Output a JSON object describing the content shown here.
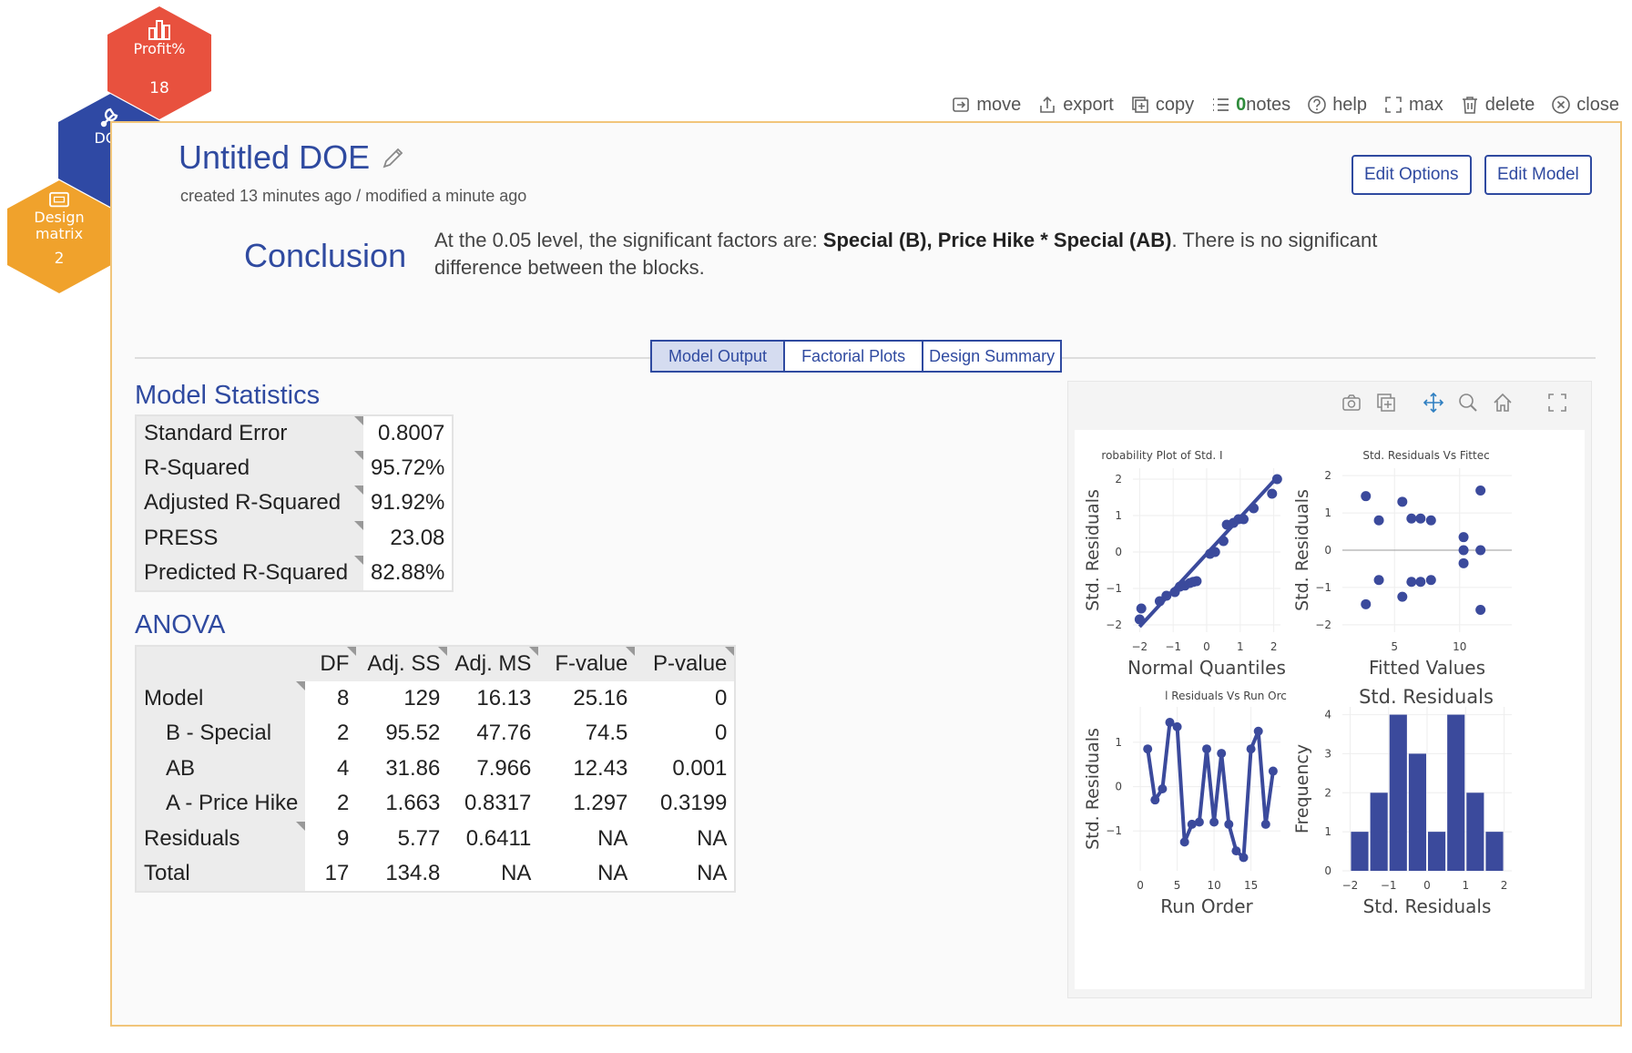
{
  "nav": {
    "profit": {
      "label": "Profit%",
      "count": "18"
    },
    "doe": {
      "label": "DOE"
    },
    "design": {
      "label_line1": "Design",
      "label_line2": "matrix",
      "count": "2"
    }
  },
  "toolbar": {
    "move": "move",
    "export": "export",
    "copy": "copy",
    "notes_count": "0",
    "notes": "notes",
    "help": "help",
    "max": "max",
    "delete": "delete",
    "close": "close"
  },
  "header": {
    "title": "Untitled DOE",
    "meta": "created 13 minutes ago / modified a minute ago",
    "edit_options": "Edit Options",
    "edit_model": "Edit Model"
  },
  "conclusion": {
    "title": "Conclusion",
    "text_before": "At the 0.05 level, the significant factors are: ",
    "text_bold": "Special (B), Price Hike * Special (AB)",
    "text_after": ". There is no significant difference between the blocks."
  },
  "tabs": [
    "Model Output",
    "Factorial Plots",
    "Design Summary"
  ],
  "model_stats": {
    "title": "Model Statistics",
    "rows": [
      {
        "label": "Standard Error",
        "value": "0.8007"
      },
      {
        "label": "R-Squared",
        "value": "95.72%"
      },
      {
        "label": "Adjusted R-Squared",
        "value": "91.92%"
      },
      {
        "label": "PRESS",
        "value": "23.08"
      },
      {
        "label": "Predicted R-Squared",
        "value": "82.88%"
      }
    ]
  },
  "anova": {
    "title": "ANOVA",
    "headers": [
      "DF",
      "Adj. SS",
      "Adj. MS",
      "F-value",
      "P-value"
    ],
    "rows": [
      {
        "label": "Model",
        "cells": [
          "8",
          "129",
          "16.13",
          "25.16",
          "0"
        ]
      },
      {
        "label": "B - Special",
        "cells": [
          "2",
          "95.52",
          "47.76",
          "74.5",
          "0"
        ]
      },
      {
        "label": "AB",
        "cells": [
          "4",
          "31.86",
          "7.966",
          "12.43",
          "0.001"
        ]
      },
      {
        "label": "A - Price Hike",
        "cells": [
          "2",
          "1.663",
          "0.8317",
          "1.297",
          "0.3199"
        ]
      },
      {
        "label": "Residuals",
        "cells": [
          "9",
          "5.77",
          "0.6411",
          "NA",
          "NA"
        ]
      },
      {
        "label": "Total",
        "cells": [
          "17",
          "134.8",
          "NA",
          "NA",
          "NA"
        ]
      }
    ]
  },
  "colors": {
    "accent": "#2f4aa0",
    "marker": "#3b4a9c",
    "profit": "#e8513e",
    "doe": "#2f49a4",
    "design": "#f0a22c",
    "panel_border": "#f1c57a"
  },
  "chart_data": [
    {
      "type": "scatter",
      "title": "robability Plot of Std. I",
      "xlabel": "Normal Quantiles",
      "ylabel": "Std. Residuals",
      "xlim": [
        -2.2,
        2.2
      ],
      "ylim": [
        -2.2,
        2.3
      ],
      "xticks": [
        "-2",
        "-1",
        "0",
        "1",
        "2"
      ],
      "xtick_vals": [
        -2,
        -1,
        0,
        1,
        2
      ],
      "yticks": [
        "-2",
        "-1",
        "0",
        "1",
        "2"
      ],
      "ytick_vals": [
        -2,
        -1,
        0,
        1,
        2
      ],
      "x": [
        -2.0,
        -1.95,
        -1.4,
        -1.2,
        -0.95,
        -0.8,
        -0.65,
        -0.5,
        -0.4,
        -0.3,
        0.1,
        0.25,
        0.5,
        0.6,
        0.8,
        0.95,
        1.1,
        1.4,
        1.95,
        2.1
      ],
      "y": [
        -1.85,
        -1.55,
        -1.35,
        -1.2,
        -1.1,
        -0.95,
        -0.92,
        -0.85,
        -0.82,
        -0.8,
        -0.05,
        0.0,
        0.3,
        0.75,
        0.8,
        0.9,
        0.9,
        1.2,
        1.6,
        2.0
      ],
      "fit_line": {
        "x": [
          -2.0,
          2.1
        ],
        "y": [
          -2.05,
          2.05
        ]
      }
    },
    {
      "type": "scatter",
      "title": "Std. Residuals Vs Fittec",
      "xlabel": "Fitted Values",
      "ylabel": "Std. Residuals",
      "xlim": [
        1,
        14
      ],
      "ylim": [
        -2.2,
        2.2
      ],
      "xticks": [
        "5",
        "10"
      ],
      "xtick_vals": [
        5,
        10
      ],
      "yticks": [
        "-2",
        "-1",
        "0",
        "1",
        "2"
      ],
      "ytick_vals": [
        -2,
        -1,
        0,
        1,
        2
      ],
      "x": [
        2.8,
        2.8,
        3.8,
        3.8,
        5.6,
        5.6,
        6.3,
        6.3,
        7.0,
        7.0,
        7.8,
        7.8,
        10.3,
        10.3,
        10.3,
        11.6,
        11.6,
        11.6
      ],
      "y": [
        1.45,
        -1.45,
        0.8,
        -0.8,
        1.3,
        -1.25,
        0.85,
        -0.85,
        0.85,
        -0.85,
        0.8,
        -0.8,
        0.35,
        0.0,
        -0.35,
        1.6,
        0.0,
        -1.6
      ],
      "hline": 0
    },
    {
      "type": "line",
      "title": "l Residuals Vs Run Orc",
      "xlabel": "Run Order",
      "ylabel": "Std. Residuals",
      "xlim": [
        -1,
        19
      ],
      "ylim": [
        -1.9,
        1.8
      ],
      "xticks": [
        "0",
        "5",
        "10",
        "15"
      ],
      "xtick_vals": [
        0,
        5,
        10,
        15
      ],
      "yticks": [
        "-1",
        "0",
        "1"
      ],
      "ytick_vals": [
        -1,
        0,
        1
      ],
      "x": [
        1,
        2,
        3,
        4,
        5,
        6,
        7,
        8,
        9,
        10,
        11,
        12,
        13,
        14,
        15,
        16,
        17,
        18
      ],
      "y": [
        0.85,
        -0.3,
        -0.05,
        1.45,
        1.35,
        -1.25,
        -0.85,
        -0.8,
        0.85,
        -0.8,
        0.75,
        -0.85,
        -1.45,
        -1.6,
        0.85,
        1.25,
        -0.85,
        0.35
      ]
    },
    {
      "type": "bar",
      "title": "Std. Residuals",
      "xlabel": "Std. Residuals",
      "ylabel": "Frequency",
      "xlim": [
        -2.2,
        2.2
      ],
      "ylim": [
        0,
        4.2
      ],
      "xticks": [
        "-2",
        "-1",
        "0",
        "1",
        "2"
      ],
      "xtick_vals": [
        -2,
        -1,
        0,
        1,
        2
      ],
      "yticks": [
        "0",
        "1",
        "2",
        "3",
        "4"
      ],
      "ytick_vals": [
        0,
        1,
        2,
        3,
        4
      ],
      "bin_edges": [
        -2.0,
        -1.5,
        -1.0,
        -0.5,
        0.0,
        0.5,
        1.0,
        1.5,
        2.0
      ],
      "values": [
        1,
        2,
        4,
        3,
        1,
        4,
        2,
        1
      ]
    }
  ]
}
